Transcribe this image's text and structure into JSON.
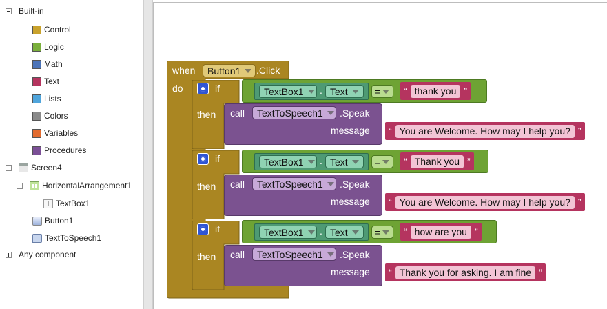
{
  "tree": {
    "builtin": {
      "label": "Built-in",
      "items": [
        {
          "label": "Control",
          "color": "#c9a22c",
          "icon": "control-swatch"
        },
        {
          "label": "Logic",
          "color": "#7aaf3b",
          "icon": "logic-swatch"
        },
        {
          "label": "Math",
          "color": "#4c74b9",
          "icon": "math-swatch"
        },
        {
          "label": "Text",
          "color": "#b5345f",
          "icon": "text-swatch"
        },
        {
          "label": "Lists",
          "color": "#4fa5dc",
          "icon": "lists-swatch"
        },
        {
          "label": "Colors",
          "color": "#8a8a8a",
          "icon": "colors-swatch"
        },
        {
          "label": "Variables",
          "color": "#e26b2f",
          "icon": "variables-swatch"
        },
        {
          "label": "Procedures",
          "color": "#7b4f96",
          "icon": "procedures-swatch"
        }
      ]
    },
    "screen": {
      "label": "Screen4"
    },
    "horizontal": {
      "label": "HorizontalArrangement1"
    },
    "textbox": {
      "label": "TextBox1"
    },
    "button": {
      "label": "Button1"
    },
    "tts": {
      "label": "TextToSpeech1"
    },
    "any": {
      "label": "Any component"
    }
  },
  "colors": {
    "control": "#aa8622",
    "logic": "#6ea334",
    "textbox": "#4e9a74",
    "procedure": "#7b5290",
    "text": "#b5345f"
  },
  "event": {
    "when": "when",
    "component": "Button1",
    "event": ".Click",
    "do": "do"
  },
  "conditions": [
    {
      "if": "if",
      "then": "then",
      "component": "TextBox1",
      "dot": ".",
      "property": "Text",
      "operator": "=",
      "compare_text": "thank you",
      "call": "call",
      "target": "TextToSpeech1",
      "method": ".Speak",
      "param": "message",
      "message": "You are Welcome. How may I help you?"
    },
    {
      "if": "if",
      "then": "then",
      "component": "TextBox1",
      "dot": ".",
      "property": "Text",
      "operator": "=",
      "compare_text": "Thank you",
      "call": "call",
      "target": "TextToSpeech1",
      "method": ".Speak",
      "param": "message",
      "message": "You are Welcome. How may I help you?"
    },
    {
      "if": "if",
      "then": "then",
      "component": "TextBox1",
      "dot": ".",
      "property": "Text",
      "operator": "=",
      "compare_text": "how are you",
      "call": "call",
      "target": "TextToSpeech1",
      "method": ".Speak",
      "param": "message",
      "message": "Thank you for asking. I am fine"
    }
  ],
  "quote_open": "“",
  "quote_close": "”"
}
